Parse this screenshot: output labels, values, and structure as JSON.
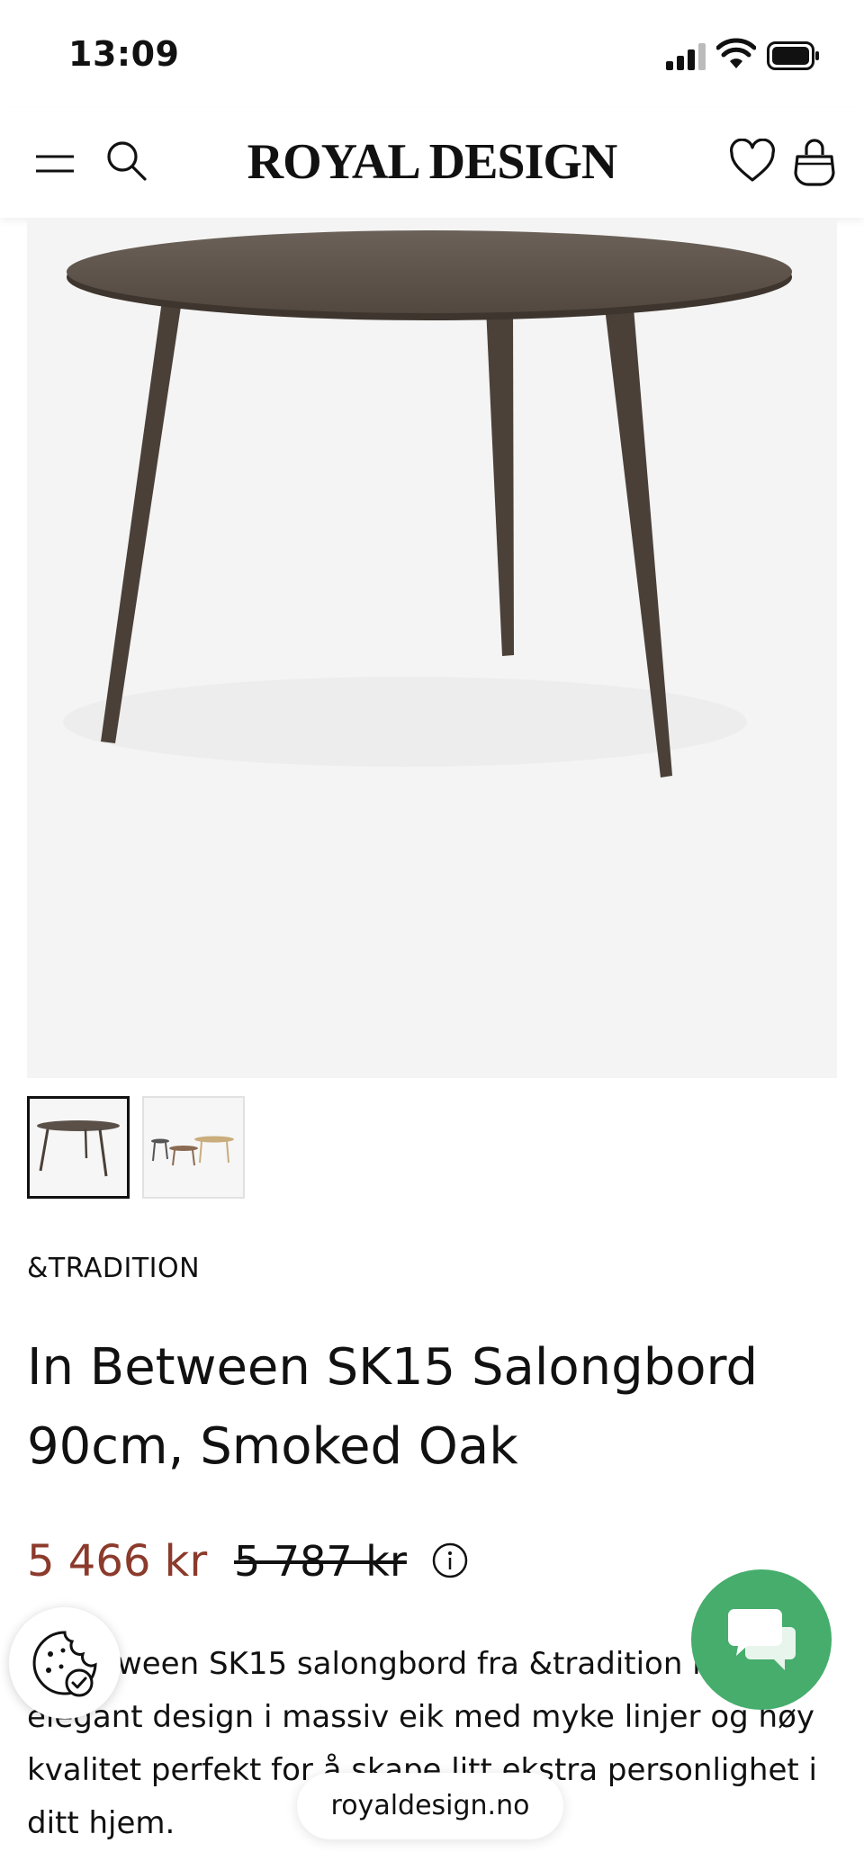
{
  "status_bar": {
    "time": "13:09"
  },
  "header": {
    "logo": "ROYAL DESIGN"
  },
  "product": {
    "brand": "&TRADITION",
    "title": "In Between SK15 Salongbord 90cm, Smoked Oak",
    "price_sale": "5 466 kr",
    "price_original": "5 787 kr",
    "description": "In Between SK15 salongbord fra &tradition med elegant design i massiv eik med myke linjer og høy kvalitet perfekt for å skape litt ekstra personlighet i ditt hjem."
  },
  "browser": {
    "url": "royaldesign.no"
  },
  "colors": {
    "sale_price": "#8b3a2b",
    "chat_button": "#46ad6d",
    "table_wood": "#5a5048"
  },
  "icons": [
    "menu-icon",
    "search-icon",
    "heart-icon",
    "bag-icon",
    "info-icon",
    "cookie-icon",
    "chat-icon",
    "signal-icon",
    "wifi-icon",
    "battery-icon"
  ]
}
